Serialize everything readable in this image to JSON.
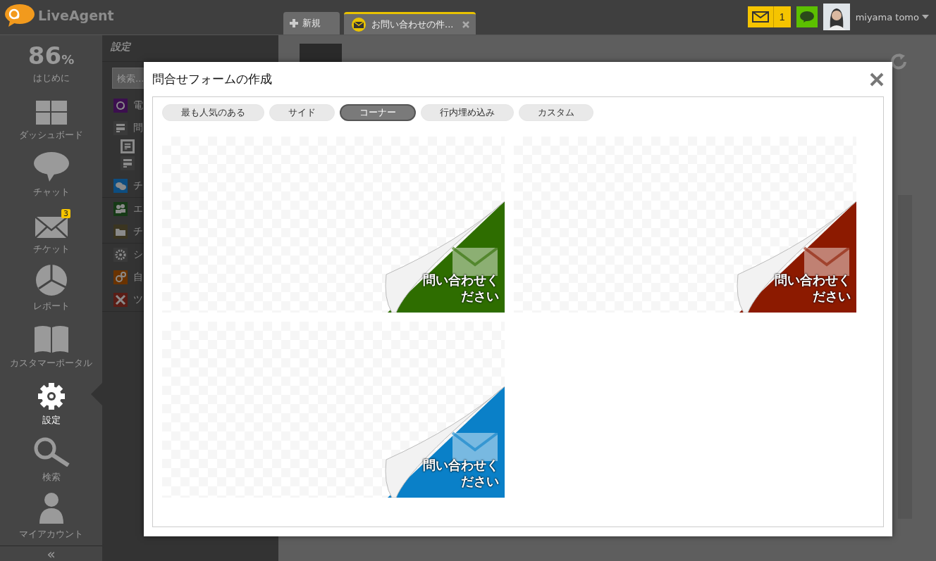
{
  "app": {
    "logo": "LiveAgent"
  },
  "tabs": [
    {
      "label": "新規",
      "kind": "new",
      "selected": false
    },
    {
      "label": "お問い合わせの件...",
      "kind": "ticket",
      "selected": true
    }
  ],
  "header": {
    "mail_count": "1",
    "user": "miyama tomo"
  },
  "nav": {
    "items": [
      {
        "kind": "progress",
        "value": "86",
        "unit": "%",
        "label": "はじめに",
        "selected": false
      },
      {
        "kind": "dashboard",
        "label": "ダッシュボード",
        "selected": false
      },
      {
        "kind": "chat",
        "label": "チャット",
        "selected": false
      },
      {
        "kind": "ticket",
        "label": "チケット",
        "badge": "3",
        "selected": false
      },
      {
        "kind": "report",
        "label": "レポート",
        "selected": false
      },
      {
        "kind": "portal",
        "label": "カスタマーポータル",
        "selected": false
      },
      {
        "kind": "settings",
        "label": "設定",
        "selected": true
      },
      {
        "kind": "search",
        "label": "検索",
        "selected": false
      },
      {
        "kind": "account",
        "label": "マイアカウント",
        "selected": false
      }
    ],
    "collapse": "«"
  },
  "settings_panel": {
    "title": "設定",
    "search_placeholder": "検索...",
    "groups": [
      [
        {
          "kind": "at",
          "label": "電",
          "color": "#3c0f4f"
        },
        {
          "kind": "form",
          "label": "問",
          "color": "#3a3a3a",
          "children": [
            {
              "kind": "form",
              "color": "#3a3a3a",
              "selected": true
            },
            {
              "kind": "form",
              "color": "#3a3a3a",
              "selected": false
            }
          ]
        },
        {
          "kind": "chat",
          "label": "チ",
          "color": "#0d4d80"
        }
      ],
      [
        {
          "kind": "people",
          "label": "エ",
          "color": "#163a16"
        },
        {
          "kind": "folder",
          "label": "チ",
          "color": "#3b3520"
        }
      ],
      [
        {
          "kind": "gear",
          "label": "シ",
          "color": "#3a3a3a"
        },
        {
          "kind": "gears",
          "label": "自",
          "color": "#6a3300"
        },
        {
          "kind": "tools",
          "label": "ツ",
          "color": "#5a1d16"
        }
      ]
    ]
  },
  "modal": {
    "title": "問合せフォームの作成",
    "filters": [
      {
        "label": "最も人気のある",
        "selected": false
      },
      {
        "label": "サイド",
        "selected": false
      },
      {
        "label": "コーナー",
        "selected": true
      },
      {
        "label": "行内埋め込み",
        "selected": false
      },
      {
        "label": "カスタム",
        "selected": false
      }
    ],
    "previews": [
      {
        "color": "#2e6d00",
        "lines": [
          "問い合わせく",
          "ださい"
        ]
      },
      {
        "color": "#8c1a00",
        "lines": [
          "問い合わせく",
          "ださい"
        ]
      },
      {
        "color": "#0a80c8",
        "lines": [
          "問い合わせく",
          "ださい"
        ]
      }
    ]
  }
}
